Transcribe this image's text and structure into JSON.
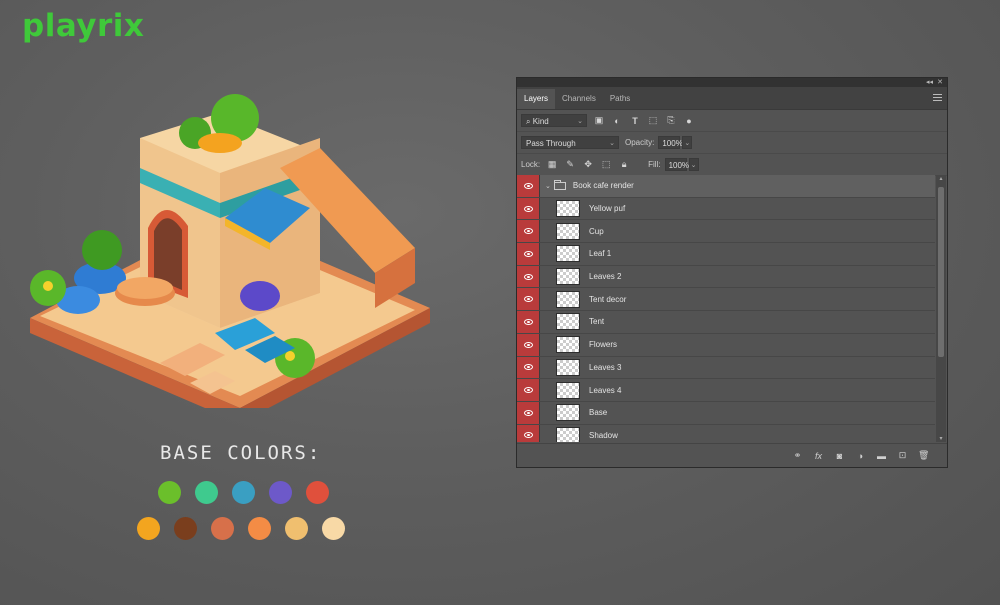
{
  "brand": {
    "logo_text": "playrix",
    "color": "#3fc93a"
  },
  "palette": {
    "title": "BASE COLORS:",
    "row1": [
      "#6bbf2b",
      "#3fca8e",
      "#3a9fc2",
      "#6d59c9",
      "#e0503c"
    ],
    "row2": [
      "#f3a51f",
      "#7a3e1d",
      "#d7704a",
      "#f48c45",
      "#f0bf6f",
      "#f8d9a6"
    ]
  },
  "panel": {
    "tabs": [
      "Layers",
      "Channels",
      "Paths"
    ],
    "active_tab": "Layers",
    "filter": {
      "label": "Kind",
      "icons": [
        "image-filter-icon",
        "adjustment-filter-icon",
        "type-filter-icon",
        "shape-filter-icon",
        "smart-object-filter-icon"
      ]
    },
    "blend_mode": "Pass Through",
    "opacity_label": "Opacity:",
    "opacity_value": "100%",
    "lock_label": "Lock:",
    "fill_label": "Fill:",
    "fill_value": "100%",
    "group": {
      "name": "Book cafe render"
    },
    "layers": [
      "Yellow puf",
      "Cup",
      "Leaf 1",
      "Leaves 2",
      "Tent decor",
      "Tent",
      "Flowers",
      "Leaves 3",
      "Leaves 4",
      "Base",
      "Shadow"
    ],
    "footer_icons": [
      "link-icon",
      "fx-icon",
      "mask-icon",
      "adjustment-icon",
      "folder-icon",
      "new-layer-icon",
      "trash-icon"
    ]
  }
}
